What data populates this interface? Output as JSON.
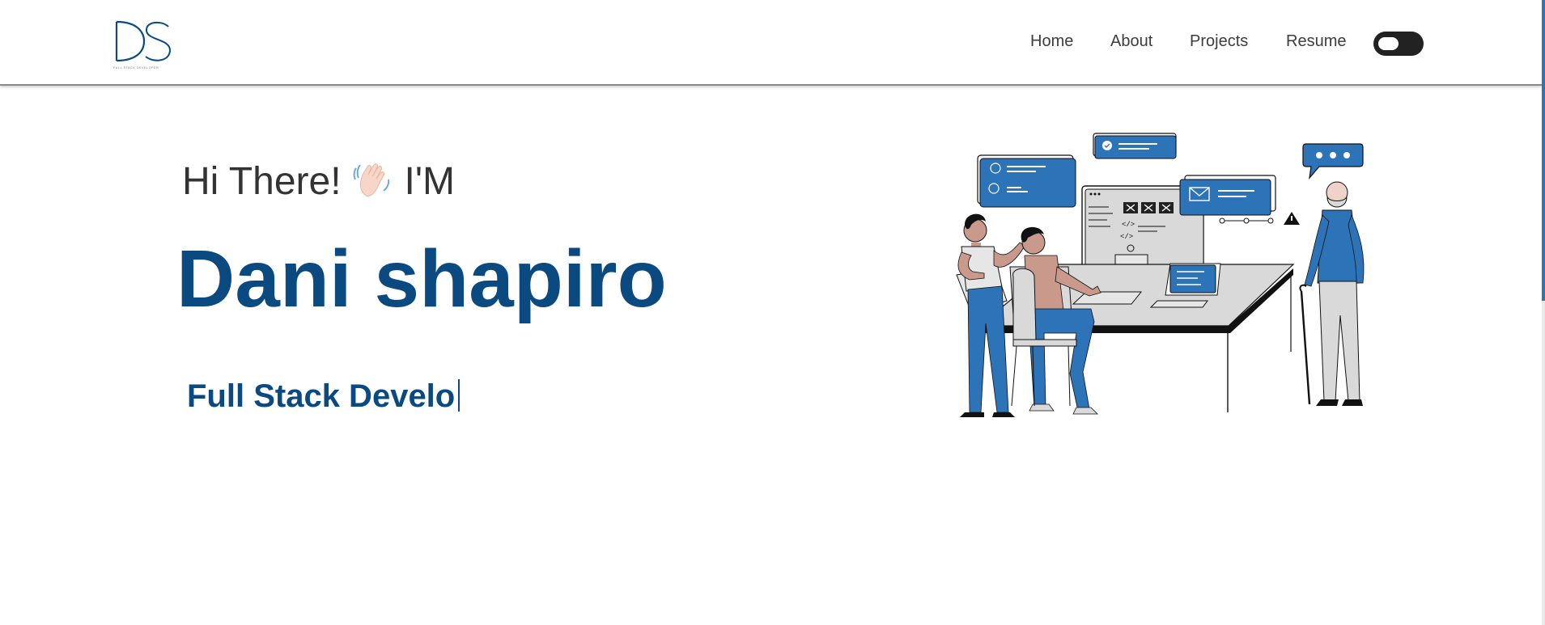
{
  "header": {
    "logo_text": "DS",
    "logo_subtext": "FULL STACK DEVELOPER",
    "nav": [
      {
        "label": "Home"
      },
      {
        "label": "About"
      },
      {
        "label": "Projects"
      },
      {
        "label": "Resume"
      }
    ],
    "theme_toggle": {
      "state": "off"
    }
  },
  "hero": {
    "greeting_before": "Hi There!",
    "greeting_after": "I'M",
    "name": "Dani shapiro",
    "role_typed": "Full Stack Develo"
  },
  "colors": {
    "brand": "#0a4a80",
    "illustration_blue": "#2d73b8",
    "text": "#333333",
    "toggle_bg": "#222222"
  },
  "icons": [
    "logo-icon",
    "wave-hand-icon",
    "developer-team-illustration"
  ]
}
